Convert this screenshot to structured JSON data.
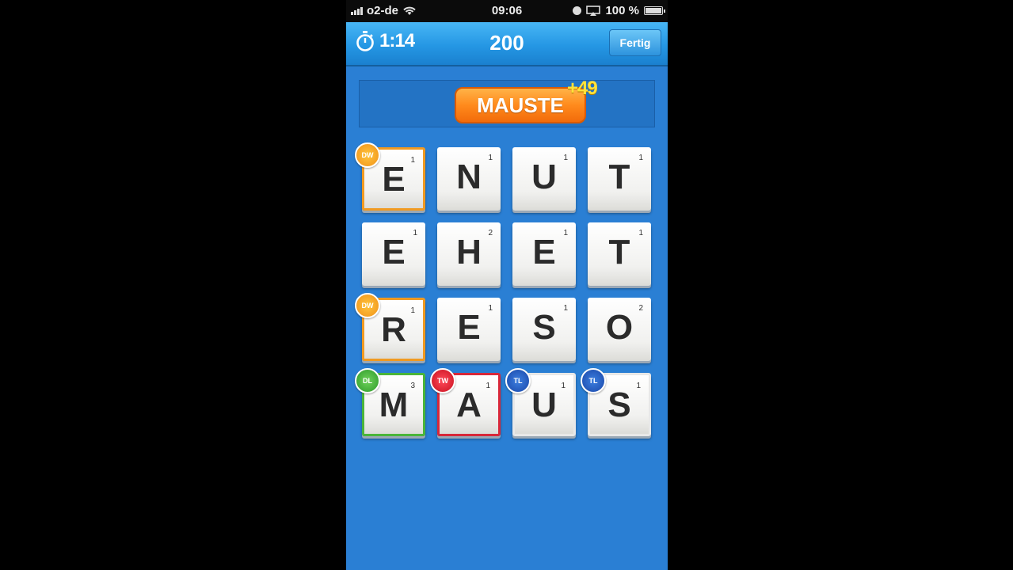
{
  "status_bar": {
    "carrier": "o2-de",
    "time": "09:06",
    "battery": "100 %"
  },
  "top_bar": {
    "timer": "1:14",
    "score": "200",
    "done_label": "Fertig"
  },
  "current_word": {
    "word": "MAUSTE",
    "points": "+49"
  },
  "board": {
    "rows": [
      [
        {
          "letter": "E",
          "points": "1",
          "bonus": "DW"
        },
        {
          "letter": "N",
          "points": "1",
          "bonus": ""
        },
        {
          "letter": "U",
          "points": "1",
          "bonus": ""
        },
        {
          "letter": "T",
          "points": "1",
          "bonus": ""
        }
      ],
      [
        {
          "letter": "E",
          "points": "1",
          "bonus": ""
        },
        {
          "letter": "H",
          "points": "2",
          "bonus": ""
        },
        {
          "letter": "E",
          "points": "1",
          "bonus": ""
        },
        {
          "letter": "T",
          "points": "1",
          "bonus": ""
        }
      ],
      [
        {
          "letter": "R",
          "points": "1",
          "bonus": "DW"
        },
        {
          "letter": "E",
          "points": "1",
          "bonus": ""
        },
        {
          "letter": "S",
          "points": "1",
          "bonus": ""
        },
        {
          "letter": "O",
          "points": "2",
          "bonus": ""
        }
      ],
      [
        {
          "letter": "M",
          "points": "3",
          "bonus": "DL"
        },
        {
          "letter": "A",
          "points": "1",
          "bonus": "TW"
        },
        {
          "letter": "U",
          "points": "1",
          "bonus": "TL"
        },
        {
          "letter": "S",
          "points": "1",
          "bonus": "TL"
        }
      ]
    ]
  },
  "colors": {
    "background": "#2a7fd4",
    "word_pill": "#ff8a1c",
    "points_text": "#ffe23a",
    "dw": "#f09a22",
    "dl": "#4ab53a",
    "tw": "#d8283a",
    "tl": "#1a47a8"
  }
}
